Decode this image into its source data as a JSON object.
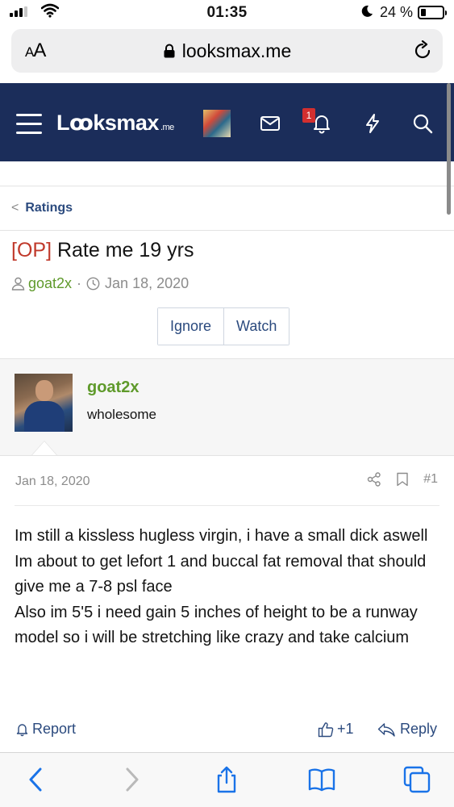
{
  "status_bar": {
    "time": "01:35",
    "battery_percent": "24 %",
    "battery_level": 0.24
  },
  "browser": {
    "text_size_label": "AA",
    "url": "looksmax.me"
  },
  "site": {
    "logo_text": "Lꝏksmax",
    "logo_suffix": ".me",
    "notification_count": "1",
    "brand_color": "#1b2d5a"
  },
  "breadcrumb": {
    "label": "Ratings"
  },
  "thread": {
    "prefix": "[OP]",
    "title": "Rate me 19 yrs",
    "author": "goat2x",
    "separator": "·",
    "date": "Jan 18, 2020",
    "buttons": {
      "ignore": "Ignore",
      "watch": "Watch"
    }
  },
  "post": {
    "username": "goat2x",
    "user_title": "wholesome",
    "date": "Jan 18, 2020",
    "number": "#1",
    "message_lines": [
      "Im still a kissless hugless virgin, i have a small dick aswell",
      "Im about to get lefort 1 and buccal fat removal that should give me a 7-8 psl face",
      "Also im 5'5 i need gain 5 inches of height to be a runway model so i will be stretching like crazy and take calcium"
    ],
    "report_label": "Report",
    "like_count": "+1",
    "reply_label": "Reply"
  },
  "icons": {
    "status": [
      "signal-icon",
      "wifi-icon",
      "moon-icon",
      "battery-icon"
    ],
    "browser": [
      "lock-icon",
      "reload-icon"
    ],
    "header": [
      "menu-icon",
      "avatar",
      "mail-icon",
      "bell-icon",
      "lightning-icon",
      "search-icon"
    ],
    "toolbar": [
      "back-icon",
      "forward-icon",
      "share-icon",
      "bookmarks-icon",
      "tabs-icon"
    ]
  }
}
